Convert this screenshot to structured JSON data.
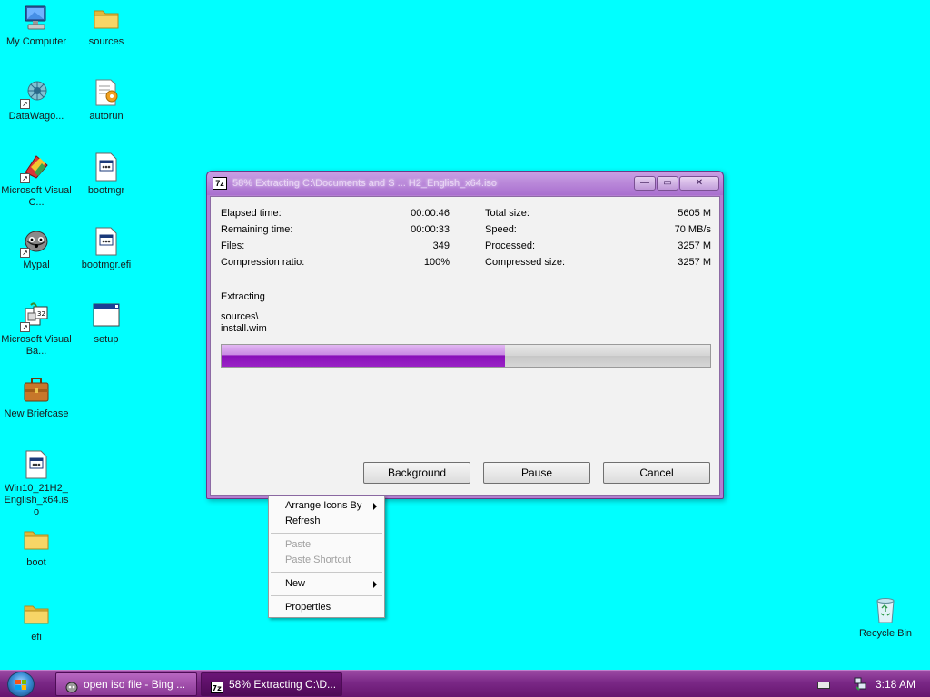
{
  "desktop": {
    "icons": [
      {
        "label": "My Computer",
        "icon": "computer-icon"
      },
      {
        "label": "sources",
        "icon": "folder-icon"
      },
      {
        "label": "DataWago...",
        "icon": "datawagon-icon"
      },
      {
        "label": "autorun",
        "icon": "autorun-settings-icon"
      },
      {
        "label": "Microsoft Visual C...",
        "icon": "visual-c-icon"
      },
      {
        "label": "bootmgr",
        "icon": "file-icon"
      },
      {
        "label": "Mypal",
        "icon": "mypal-browser-icon"
      },
      {
        "label": "bootmgr.efi",
        "icon": "file-icon"
      },
      {
        "label": "Microsoft Visual Ba...",
        "icon": "visual-basic-icon"
      },
      {
        "label": "setup",
        "icon": "window-app-icon"
      },
      {
        "label": "New Briefcase",
        "icon": "briefcase-icon"
      },
      {
        "label": "Win10_21H2_English_x64.iso",
        "icon": "file-icon"
      },
      {
        "label": "boot",
        "icon": "folder-icon"
      },
      {
        "label": "efi",
        "icon": "folder-icon"
      },
      {
        "label": "Recycle Bin",
        "icon": "recycle-bin-icon"
      }
    ]
  },
  "dialog": {
    "app_icon_label": "7z",
    "title": "58% Extracting C:\\Documents and S ... H2_English_x64.iso",
    "window_buttons": {
      "minimize": "—",
      "maximize": "▭",
      "close": "✕"
    },
    "stats_left": [
      {
        "label": "Elapsed time:",
        "value": "00:00:46"
      },
      {
        "label": "Remaining time:",
        "value": "00:00:33"
      },
      {
        "label": "Files:",
        "value": "349"
      },
      {
        "label": "Compression ratio:",
        "value": "100%"
      }
    ],
    "stats_right": [
      {
        "label": "Total size:",
        "value": "5605 M"
      },
      {
        "label": "Speed:",
        "value": "70 MB/s"
      },
      {
        "label": "Processed:",
        "value": "3257 M"
      },
      {
        "label": "Compressed size:",
        "value": "3257 M"
      }
    ],
    "status": "Extracting",
    "current_folder": "sources\\",
    "current_file": "install.wim",
    "progress_percent": 58,
    "buttons": {
      "background": "Background",
      "pause": "Pause",
      "cancel": "Cancel"
    }
  },
  "context_menu": {
    "items": [
      {
        "label": "Arrange Icons By",
        "submenu": true,
        "enabled": true
      },
      {
        "label": "Refresh",
        "submenu": false,
        "enabled": true
      },
      {
        "label": "Paste",
        "submenu": false,
        "enabled": false
      },
      {
        "label": "Paste Shortcut",
        "submenu": false,
        "enabled": false
      },
      {
        "label": "New",
        "submenu": true,
        "enabled": true
      },
      {
        "label": "Properties",
        "submenu": false,
        "enabled": true
      }
    ]
  },
  "taskbar": {
    "tasks": [
      {
        "label": "open iso file - Bing ...",
        "icon": "mypal-browser-icon",
        "active": false
      },
      {
        "label": "58% Extracting C:\\D...",
        "icon": "7zip-icon",
        "active": true
      }
    ],
    "clock": "3:18 AM"
  },
  "colors": {
    "desktop_background": "#00ffff",
    "accent_purple": "#8a1fbd",
    "taskbar": "#7a2886"
  }
}
